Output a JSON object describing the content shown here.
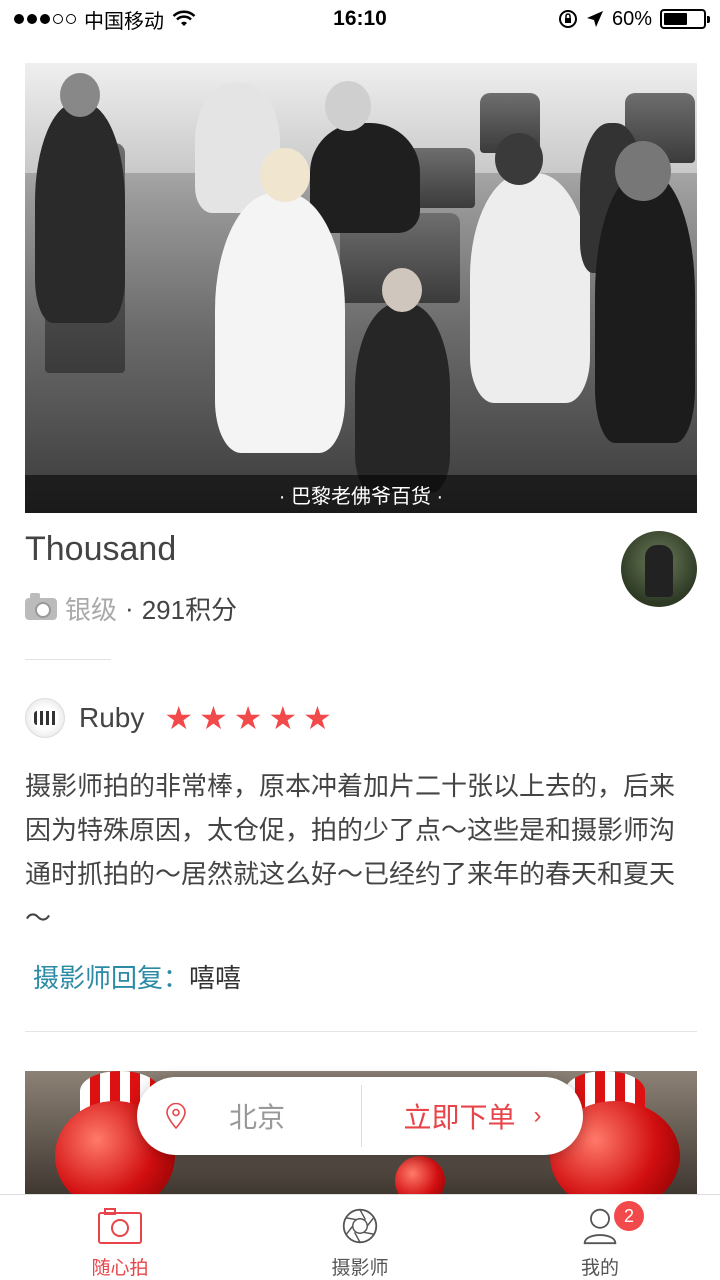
{
  "status_bar": {
    "carrier": "中国移动",
    "time": "16:10",
    "battery_percent": "60%",
    "battery_level": 0.6
  },
  "hero": {
    "caption": "· 巴黎老佛爷百货 ·"
  },
  "photographer": {
    "name": "Thousand",
    "level": "银级",
    "separator": "·",
    "points": "291积分"
  },
  "review": {
    "user": "Ruby",
    "rating": 5,
    "text": "摄影师拍的非常棒，原本冲着加片二十张以上去的，后来因为特殊原因，太仓促，拍的少了点～这些是和摄影师沟通时抓拍的～居然就这么好～已经约了来年的春天和夏天～",
    "reply_label": "摄影师回复：",
    "reply_text": "嘻嘻"
  },
  "order_bar": {
    "city": "北京",
    "order_label": "立即下单",
    "chevron": "›"
  },
  "tabbar": {
    "items": [
      {
        "label": "随心拍",
        "icon": "camera-icon",
        "active": true
      },
      {
        "label": "摄影师",
        "icon": "aperture-icon",
        "active": false
      },
      {
        "label": "我的",
        "icon": "user-icon",
        "active": false,
        "badge": "2"
      }
    ]
  },
  "colors": {
    "accent": "#e8454a",
    "star": "#f2494b",
    "reply_label": "#2b8aa5"
  }
}
